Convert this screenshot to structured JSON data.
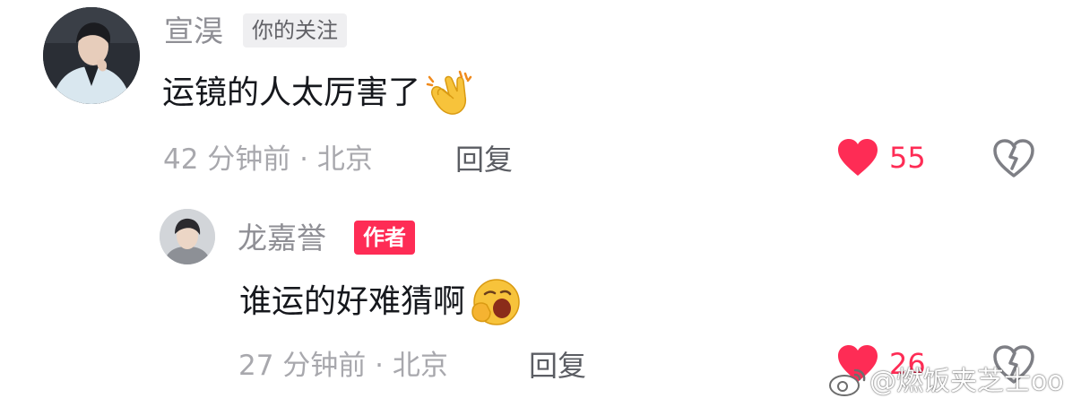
{
  "comment": {
    "username": "宣淏",
    "badge": "你的关注",
    "text": "运镜的人太厉害了",
    "emoji": "clapping-hands",
    "time": "42 分钟前 · 北京",
    "reply_label": "回复",
    "like_count": "55",
    "liked": true
  },
  "reply": {
    "username": "龙嘉誉",
    "badge": "作者",
    "text": "谁运的好难猜啊",
    "emoji": "yawning-face",
    "time": "27 分钟前 · 北京",
    "reply_label": "回复",
    "like_count": "26",
    "liked": true
  },
  "watermark": "@燃饭夹芝士oo",
  "colors": {
    "accent": "#fe2c55",
    "username": "#8f8f95",
    "meta": "#a8a8ad",
    "text": "#16181d"
  }
}
